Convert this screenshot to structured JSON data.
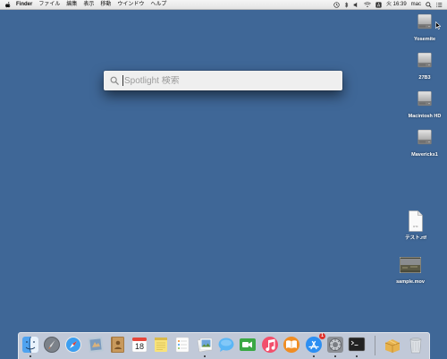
{
  "menubar": {
    "app_name": "Finder",
    "menus": [
      "ファイル",
      "編集",
      "表示",
      "移動",
      "ウインドウ",
      "ヘルプ"
    ],
    "time": "火 16:39",
    "user": "mac"
  },
  "desktop_icons": [
    {
      "label": "Yosemite"
    },
    {
      "label": "27B3"
    },
    {
      "label": "Macintosh HD"
    },
    {
      "label": "Mavericks1"
    },
    {
      "label": "テスト.rtf",
      "doc_text": "RTF"
    },
    {
      "label": "sample.mov"
    }
  ],
  "spotlight": {
    "placeholder": "Spotlight 検索",
    "value": ""
  },
  "dock": {
    "items": [
      {
        "name": "finder",
        "icon": "finder-icon"
      },
      {
        "name": "launchpad",
        "icon": "launchpad-icon"
      },
      {
        "name": "safari",
        "icon": "safari-icon"
      },
      {
        "name": "mail",
        "icon": "mail-icon"
      },
      {
        "name": "contacts",
        "icon": "contacts-icon"
      },
      {
        "name": "calendar",
        "icon": "calendar-icon",
        "date": "18"
      },
      {
        "name": "notes",
        "icon": "notes-icon"
      },
      {
        "name": "reminders",
        "icon": "reminders-icon"
      },
      {
        "name": "photos",
        "icon": "preview-icon"
      },
      {
        "name": "messages",
        "icon": "messages-icon"
      },
      {
        "name": "facetime",
        "icon": "facetime-icon"
      },
      {
        "name": "itunes",
        "icon": "itunes-icon"
      },
      {
        "name": "ibooks",
        "icon": "ibooks-icon"
      },
      {
        "name": "app-store",
        "icon": "app-store-icon",
        "badge": "1"
      },
      {
        "name": "system-preferences",
        "icon": "system-preferences-icon"
      },
      {
        "name": "terminal",
        "icon": "terminal-icon"
      },
      {
        "name": "archive",
        "icon": "archive-icon"
      },
      {
        "name": "trash",
        "icon": "trash-icon"
      }
    ]
  },
  "colors": {
    "desktop": "#3f6797",
    "menubar": "#ececec",
    "badge": "#e0312b"
  }
}
